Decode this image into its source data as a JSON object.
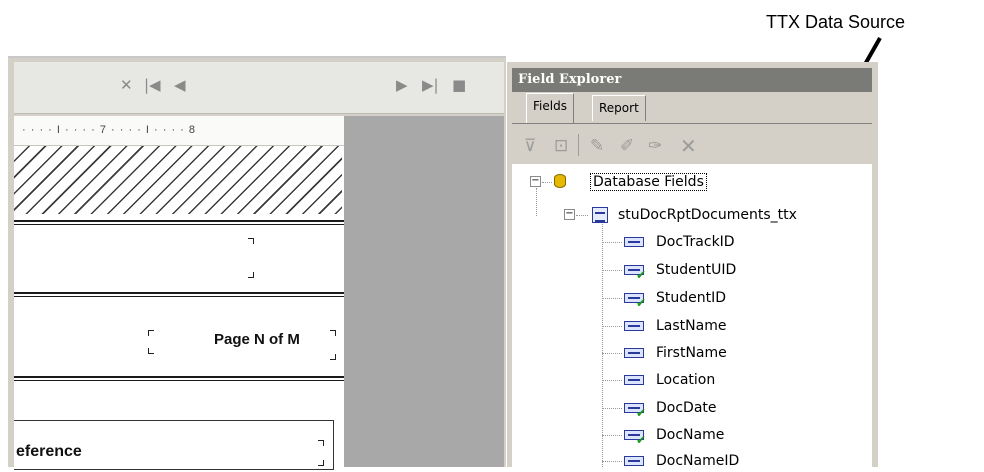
{
  "annotation": {
    "label": "TTX Data Source"
  },
  "designer": {
    "ruler_text": "· · · · I · · · · 7 · · · · I · · · · 8",
    "page_field": "Page N of M",
    "reference_text": "eference",
    "nav": {
      "close": "✕",
      "first": "|◀",
      "prev": "◀",
      "next": "▶",
      "last": "▶|",
      "stop": "■"
    }
  },
  "field_explorer": {
    "title": "Field Explorer",
    "tabs": [
      "Fields",
      "Report"
    ],
    "toolbar_icons": [
      "insert-field-icon",
      "browse-data-icon",
      "new-formula-icon",
      "edit-icon",
      "rename-icon",
      "delete-icon"
    ],
    "tree": {
      "root": "Database Fields",
      "table": "stuDocRptDocuments_ttx",
      "fields": [
        {
          "name": "DocTrackID",
          "checked": false
        },
        {
          "name": "StudentUID",
          "checked": true
        },
        {
          "name": "StudentID",
          "checked": true
        },
        {
          "name": "LastName",
          "checked": false
        },
        {
          "name": "FirstName",
          "checked": false
        },
        {
          "name": "Location",
          "checked": false
        },
        {
          "name": "DocDate",
          "checked": true
        },
        {
          "name": "DocName",
          "checked": true
        },
        {
          "name": "DocNameID",
          "checked": false
        }
      ]
    }
  },
  "colors": {
    "title_bar": "#7a7a76",
    "panel": "#d4d0c8",
    "designer_grey": "#a8a8a8"
  }
}
